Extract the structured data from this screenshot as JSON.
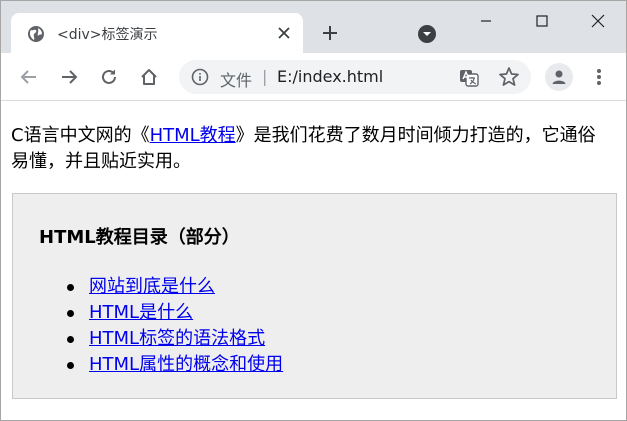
{
  "tab": {
    "title": "<div>标签演示",
    "globe_icon": "globe-icon",
    "close_icon": "close-icon"
  },
  "new_tab_icon": "plus-icon",
  "window_controls": {
    "minimize": "minimize-icon",
    "maximize": "maximize-icon",
    "close": "close-icon"
  },
  "toolbar": {
    "scheme_label": "文件",
    "separator": "|",
    "url": "E:/index.html"
  },
  "page": {
    "intro_before": "C语言中文网的《",
    "intro_link": "HTML教程",
    "intro_after": "》是我们花费了数月时间倾力打造的，它通俗易懂，并且贴近实用。",
    "panel_title": "HTML教程目录（部分）",
    "links": [
      {
        "label": "网站到底是什么"
      },
      {
        "label": "HTML是什么"
      },
      {
        "label": "HTML标签的语法格式"
      },
      {
        "label": "HTML属性的概念和使用"
      }
    ]
  },
  "colors": {
    "tabstrip_bg": "#dee1e6",
    "link": "#0000ee",
    "panel_bg": "#eeeeee"
  }
}
